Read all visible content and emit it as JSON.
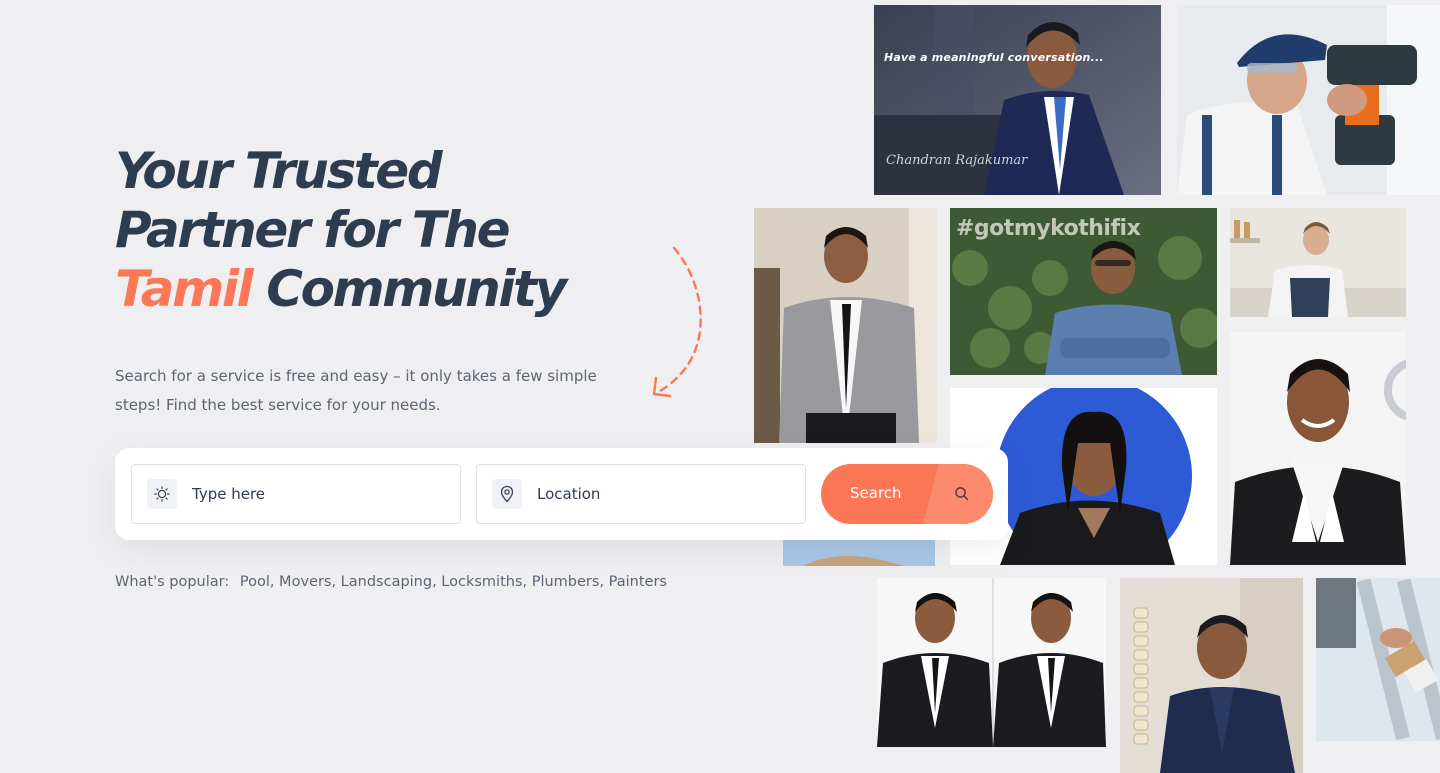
{
  "hero": {
    "title_line1": "Your Trusted",
    "title_line2": "Partner for The",
    "title_accent": "Tamil",
    "title_line3_rest": " Community",
    "subtitle": "Search for a service is free and easy – it only takes a few simple steps!  Find the best service for your needs."
  },
  "search": {
    "type_placeholder": "Type here",
    "location_placeholder": "Location",
    "button_label": "Search"
  },
  "popular": {
    "label": "What's popular:",
    "items": "Pool, Movers, Landscaping, Locksmiths, Plumbers, Painters"
  },
  "collage": {
    "tile1_caption": "Have a meaningful conversation...",
    "tile1_signature": "Chandran Rajakumar",
    "tile3_hashtag": "#gotmykothifix"
  },
  "colors": {
    "accent": "#fb7756",
    "heading": "#2e3c4f",
    "background": "#efeff1"
  }
}
